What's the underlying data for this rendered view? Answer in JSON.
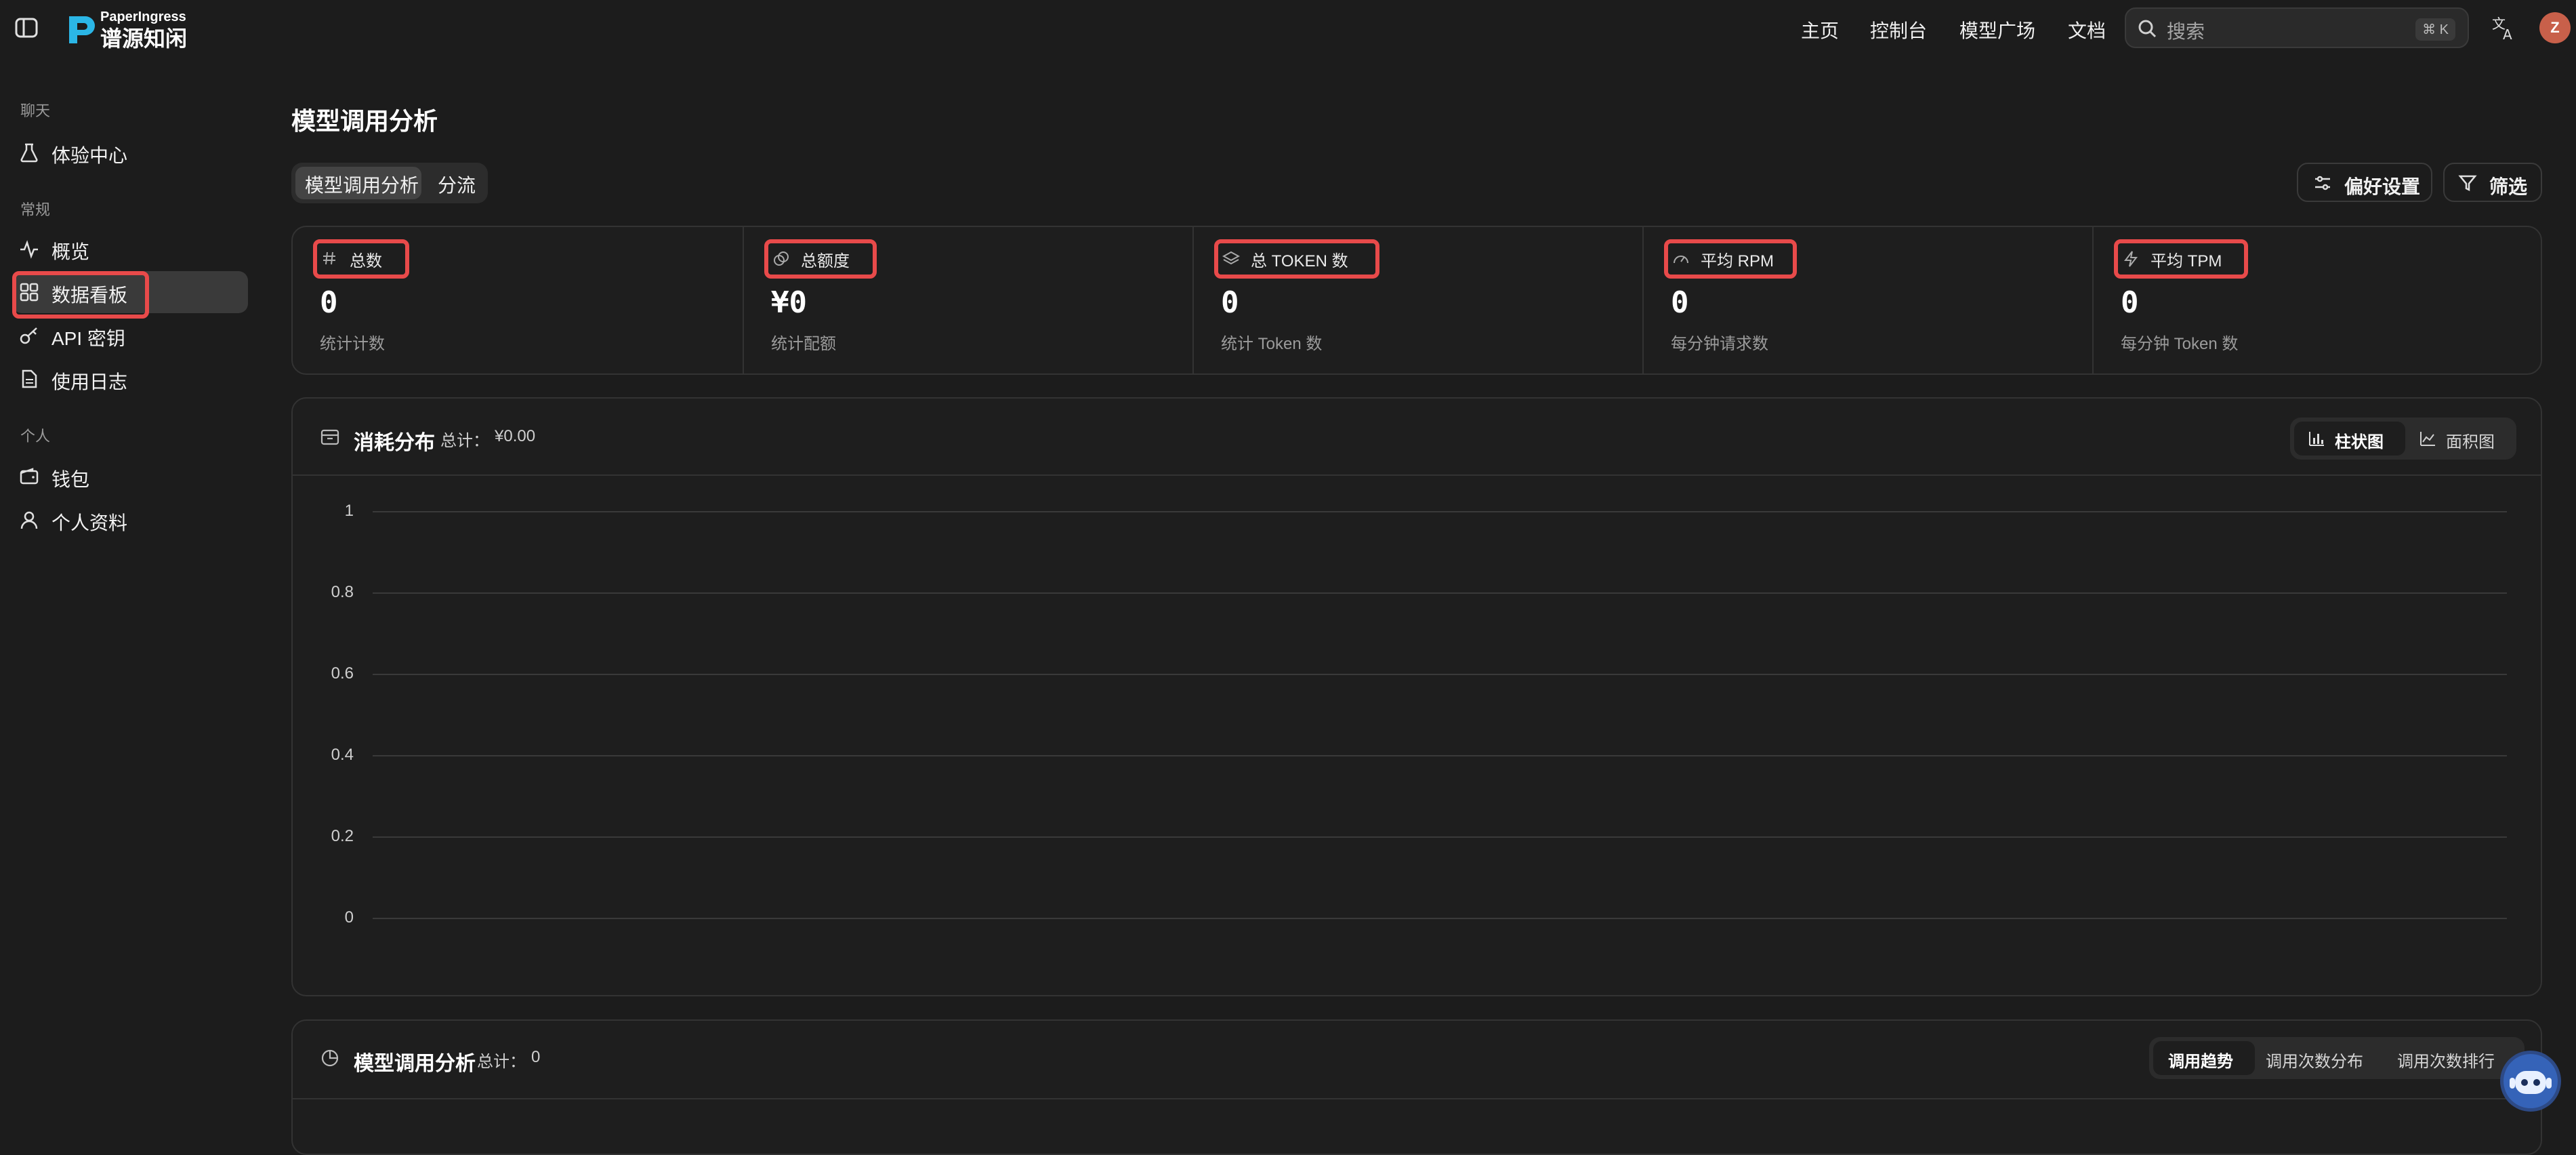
{
  "header": {
    "brand_sub": "PaperIngress",
    "brand_main": "谱源知闲",
    "nav": [
      "主页",
      "控制台",
      "模型广场",
      "文档"
    ],
    "search": {
      "placeholder": "搜索",
      "shortcut": "⌘ K"
    },
    "avatar_letter": "Z"
  },
  "sidebar": {
    "sections": [
      {
        "label": "聊天",
        "items": [
          {
            "label": "体验中心",
            "icon": "flask-icon"
          }
        ]
      },
      {
        "label": "常规",
        "items": [
          {
            "label": "概览",
            "icon": "activity-icon"
          },
          {
            "label": "数据看板",
            "icon": "dashboard-icon",
            "active": true
          },
          {
            "label": "API 密钥",
            "icon": "key-icon"
          },
          {
            "label": "使用日志",
            "icon": "document-icon"
          }
        ]
      },
      {
        "label": "个人",
        "items": [
          {
            "label": "钱包",
            "icon": "wallet-icon"
          },
          {
            "label": "个人资料",
            "icon": "user-icon"
          }
        ]
      }
    ]
  },
  "main": {
    "title": "模型调用分析",
    "tabs": [
      "模型调用分析",
      "分流"
    ],
    "actions": {
      "preferences": "偏好设置",
      "filter": "筛选"
    },
    "stats": [
      {
        "label": "总数",
        "value": "0",
        "desc": "统计计数",
        "icon": "hash-icon"
      },
      {
        "label": "总额度",
        "value": "¥0",
        "desc": "统计配额",
        "icon": "coins-icon"
      },
      {
        "label": "总 TOKEN 数",
        "value": "0",
        "desc": "统计 Token 数",
        "icon": "layers-icon"
      },
      {
        "label": "平均 RPM",
        "value": "0",
        "desc": "每分钟请求数",
        "icon": "gauge-icon"
      },
      {
        "label": "平均 TPM",
        "value": "0",
        "desc": "每分钟 Token 数",
        "icon": "zap-icon"
      }
    ],
    "consumption": {
      "title": "消耗分布",
      "total_label": "总计：",
      "total_value": "¥0.00",
      "toggle": [
        "柱状图",
        "面积图"
      ]
    },
    "model_calls": {
      "title": "模型调用分析",
      "total_label": "总计：",
      "total_value": "0",
      "toggle": [
        "调用趋势",
        "调用次数分布",
        "调用次数排行"
      ]
    }
  },
  "chart_data": {
    "type": "bar",
    "categories": [],
    "values": [],
    "ylim": [
      0,
      1
    ],
    "yticks": [
      "1",
      "0.8",
      "0.6",
      "0.4",
      "0.2",
      "0"
    ],
    "grid": true
  }
}
